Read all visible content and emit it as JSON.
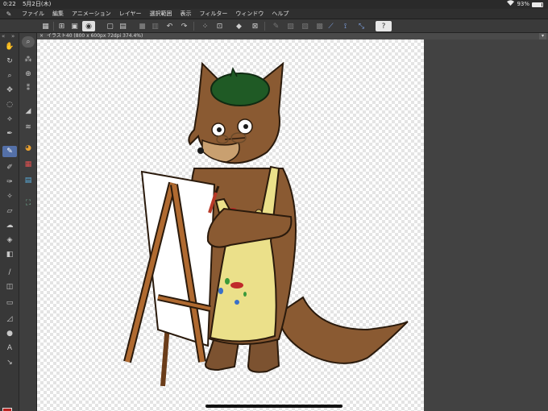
{
  "status": {
    "time": "0:22",
    "date": "5月2日(木)",
    "battery": "93%",
    "battery_level": 0.93
  },
  "menu": [
    "ファイル",
    "編集",
    "アニメーション",
    "レイヤー",
    "選択範囲",
    "表示",
    "フィルター",
    "ウィンドウ",
    "ヘルプ"
  ],
  "document": {
    "title": "イラスト40 (800 x 600px 72dpi 374.4%)"
  },
  "colors": {
    "main": "#b8231f",
    "sub": "#ffffff",
    "active_tool": "#5470a8"
  }
}
